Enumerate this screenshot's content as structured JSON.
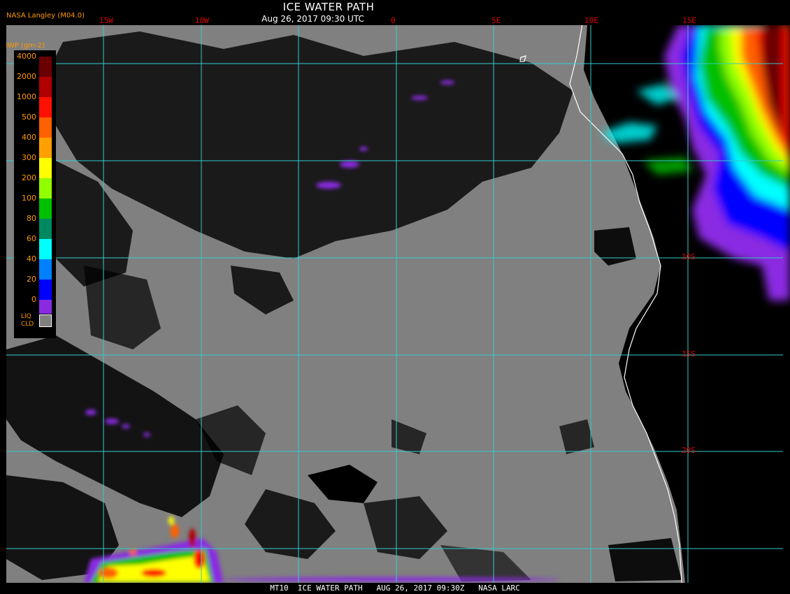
{
  "header": {
    "agency": "NASA Langley (M04.0)",
    "title": "ICE WATER PATH",
    "subtitle": "Aug 26, 2017 09:30 UTC"
  },
  "map": {
    "longitude_labels": [
      "15W",
      "10W",
      "0",
      "5E",
      "10E",
      "15E"
    ],
    "latitude_labels": [
      "10S",
      "15S",
      "20S"
    ],
    "colors": {
      "liquid_cloud": "#808080",
      "clear": "#000000",
      "gridline": "#33cccc",
      "coastline": "#ffffff",
      "grid_label": "#e00000"
    }
  },
  "legend": {
    "title": "IWP (gm-2)",
    "levels": [
      {
        "label": "4000",
        "color": "#6b0000"
      },
      {
        "label": "2000",
        "color": "#b00000"
      },
      {
        "label": "1000",
        "color": "#ff1000"
      },
      {
        "label": "500",
        "color": "#ff6000"
      },
      {
        "label": "400",
        "color": "#ffa000"
      },
      {
        "label": "300",
        "color": "#ffff00"
      },
      {
        "label": "200",
        "color": "#90ff00"
      },
      {
        "label": "100",
        "color": "#00c000"
      },
      {
        "label": "80",
        "color": "#008860"
      },
      {
        "label": "60",
        "color": "#00ffff"
      },
      {
        "label": "40",
        "color": "#0080ff"
      },
      {
        "label": "20",
        "color": "#0000ff"
      },
      {
        "label": "0",
        "color": "#8a2be2"
      }
    ],
    "liquid_cloud_label": "LIQ\nCLD"
  },
  "footer": {
    "text": "MT10  ICE WATER PATH   AUG 26, 2017 09:30Z   NASA LARC"
  }
}
